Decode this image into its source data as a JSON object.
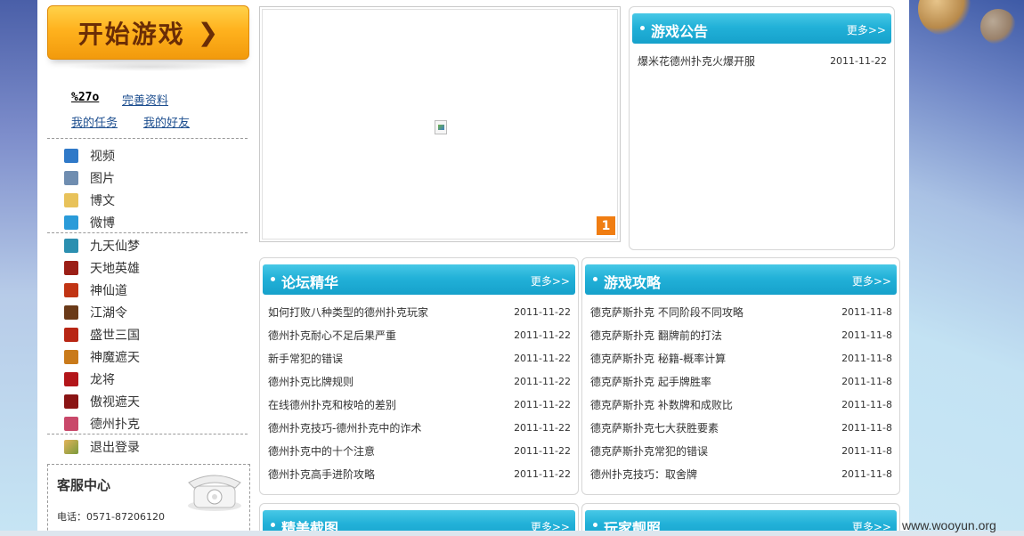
{
  "sidebar": {
    "start_label": "开始游戏",
    "username": "%27o",
    "links": [
      "完善资料",
      "我的任务",
      "我的好友"
    ],
    "media_items": [
      {
        "label": "视频",
        "icon": "video-icon",
        "color": "#2f79c8"
      },
      {
        "label": "图片",
        "icon": "picture-icon",
        "color": "#6f8db0"
      },
      {
        "label": "博文",
        "icon": "book-icon",
        "color": "#e8c25a"
      },
      {
        "label": "微博",
        "icon": "weibo-icon",
        "color": "#2a9bd9"
      }
    ],
    "games": [
      {
        "label": "九天仙梦",
        "icon": "jiutian-icon",
        "color": "#2b8fb0"
      },
      {
        "label": "天地英雄",
        "icon": "tiandi-icon",
        "color": "#9b1e16"
      },
      {
        "label": "神仙道",
        "icon": "shenxian-icon",
        "color": "#c13414"
      },
      {
        "label": "江湖令",
        "icon": "jianghu-icon",
        "color": "#6a3a18"
      },
      {
        "label": "盛世三国",
        "icon": "sanguo-icon",
        "color": "#b82614"
      },
      {
        "label": "神魔遮天",
        "icon": "shenmo-icon",
        "color": "#c97a1a"
      },
      {
        "label": "龙将",
        "icon": "longjiang-icon",
        "color": "#b3161a"
      },
      {
        "label": "傲视遮天",
        "icon": "aoshi-icon",
        "color": "#8a1414"
      },
      {
        "label": "德州扑克",
        "icon": "poker-icon",
        "color": "#c9486a"
      }
    ],
    "logout_label": "退出登录",
    "service": {
      "title": "客服中心",
      "phone": "电话：0571-87206120"
    }
  },
  "slider": {
    "index": "1"
  },
  "notice": {
    "title": "游戏公告",
    "more": "更多>>",
    "items": [
      {
        "text": "爆米花德州扑克火爆开服",
        "date": "2011-11-22"
      }
    ]
  },
  "forum": {
    "title": "论坛精华",
    "more": "更多>>",
    "items": [
      {
        "text": "如何打败八种类型的德州扑克玩家",
        "date": "2011-11-22"
      },
      {
        "text": "德州扑克耐心不足后果严重",
        "date": "2011-11-22"
      },
      {
        "text": "新手常犯的错误",
        "date": "2011-11-22"
      },
      {
        "text": "德州扑克比牌规则",
        "date": "2011-11-22"
      },
      {
        "text": "在线德州扑克和桉哈的差别",
        "date": "2011-11-22"
      },
      {
        "text": "德州扑克技巧-德州扑克中的诈术",
        "date": "2011-11-22"
      },
      {
        "text": "德州扑克中的十个注意",
        "date": "2011-11-22"
      },
      {
        "text": "德州扑克高手进阶攻略",
        "date": "2011-11-22"
      }
    ]
  },
  "guide": {
    "title": "游戏攻略",
    "more": "更多>>",
    "items": [
      {
        "text": "德克萨斯扑克 不同阶段不同攻略",
        "date": "2011-11-8"
      },
      {
        "text": "德克萨斯扑克 翻牌前的打法",
        "date": "2011-11-8"
      },
      {
        "text": "德克萨斯扑克 秘籍-概率计算",
        "date": "2011-11-8"
      },
      {
        "text": "德克萨斯扑克 起手牌胜率",
        "date": "2011-11-8"
      },
      {
        "text": "德克萨斯扑克 补数牌和成败比",
        "date": "2011-11-8"
      },
      {
        "text": "德克萨斯扑克七大获胜要素",
        "date": "2011-11-8"
      },
      {
        "text": "德克萨斯扑克常犯的错误",
        "date": "2011-11-8"
      },
      {
        "text": "德州扑克技巧：取舍牌",
        "date": "2011-11-8"
      }
    ]
  },
  "screenshots": {
    "title": "精美截图",
    "more": "更多>>"
  },
  "players": {
    "title": "玩家靓照",
    "more": "更多>>"
  },
  "watermark": "www.wooyun.org"
}
